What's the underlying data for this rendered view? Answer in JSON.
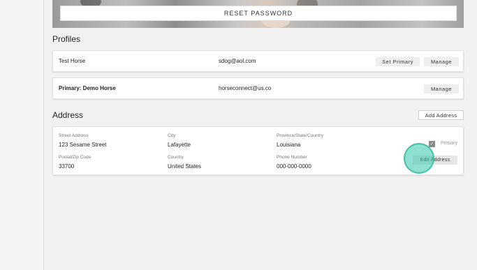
{
  "reset_password": {
    "label": "RESET PASSWORD"
  },
  "profiles": {
    "title": "Profiles",
    "items": [
      {
        "name": "Test Horse",
        "email": "sdog@aol.com",
        "set_primary_label": "Set Primary",
        "manage_label": "Manage"
      },
      {
        "name": "Primary: Demo Horse",
        "email": "horseconnect@us.co",
        "manage_label": "Manage"
      }
    ]
  },
  "address": {
    "title": "Address",
    "add_label": "Add Address",
    "street_label": "Street Address",
    "street_value": "123 Sesame Street",
    "city_label": "City",
    "city_value": "Lafayette",
    "province_label": "Province/State/Country",
    "province_value": "Louisiana",
    "zip_label": "Postal/Zip Code",
    "zip_value": "33700",
    "country_label": "Country",
    "country_value": "United States",
    "phone_label": "Phone Number",
    "phone_value": "000-000-0000",
    "primary_label": "Primary",
    "primary_checked": true,
    "edit_label": "Edit Address"
  },
  "colors": {
    "accent_highlight": "#32c8aa",
    "card_bg": "#ffffff",
    "page_bg": "#f2f2f2"
  }
}
